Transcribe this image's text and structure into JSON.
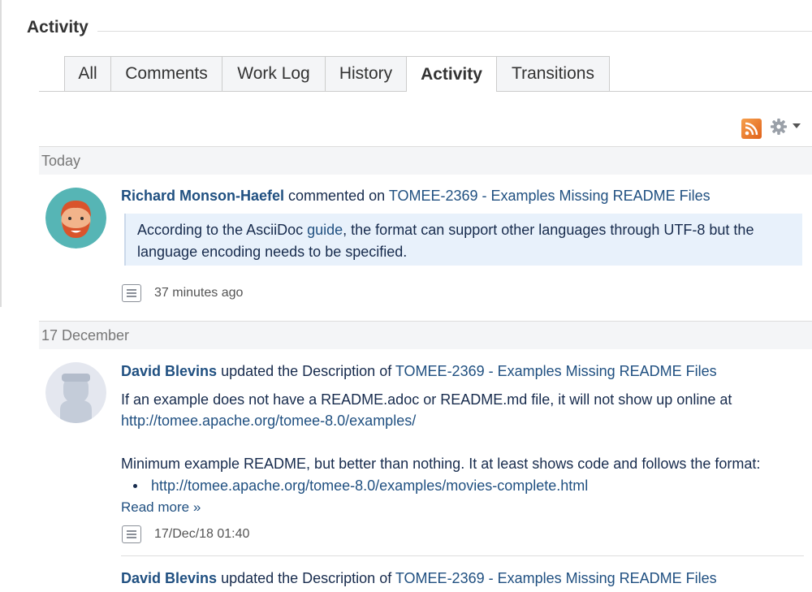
{
  "section": {
    "title": "Activity"
  },
  "tabs": [
    "All",
    "Comments",
    "Work Log",
    "History",
    "Activity",
    "Transitions"
  ],
  "active_tab": "Activity",
  "toolbar": {
    "rss_icon": "rss-feed-icon",
    "settings_icon": "gear-icon"
  },
  "groups": [
    {
      "date": "Today",
      "entries": [
        {
          "author": "Richard Monson-Haefel",
          "action": "commented on",
          "issue": "TOMEE-2369 - Examples Missing README Files",
          "comment_before": "According to the AsciiDoc ",
          "comment_link": "guide",
          "comment_after_line1": ", the format can support other languages through UTF-8 but the",
          "comment_line2": "language encoding needs to be specified.",
          "time": "37 minutes ago"
        }
      ]
    },
    {
      "date": "17 December",
      "entries": [
        {
          "author": "David Blevins",
          "action": "updated the Description of",
          "issue": "TOMEE-2369 - Examples Missing README Files",
          "text_line1": "If an example does not have a README.adoc or README.md file, it will not show up online at",
          "url1": "http://tomee.apache.org/tomee-8.0/examples/",
          "text_line2": "Minimum example README, but better than nothing.  It at least shows code and follows the format:",
          "bullet_link": "http://tomee.apache.org/tomee-8.0/examples/movies-complete.html",
          "read_more": "Read more »",
          "time": "17/Dec/18 01:40"
        },
        {
          "author": "David Blevins",
          "action": "updated the Description of",
          "issue": "TOMEE-2369 - Examples Missing README Files"
        }
      ]
    }
  ],
  "colors": {
    "link": "#205081",
    "quote_bg": "#e8f1fb",
    "date_band_bg": "#f4f5f7"
  }
}
